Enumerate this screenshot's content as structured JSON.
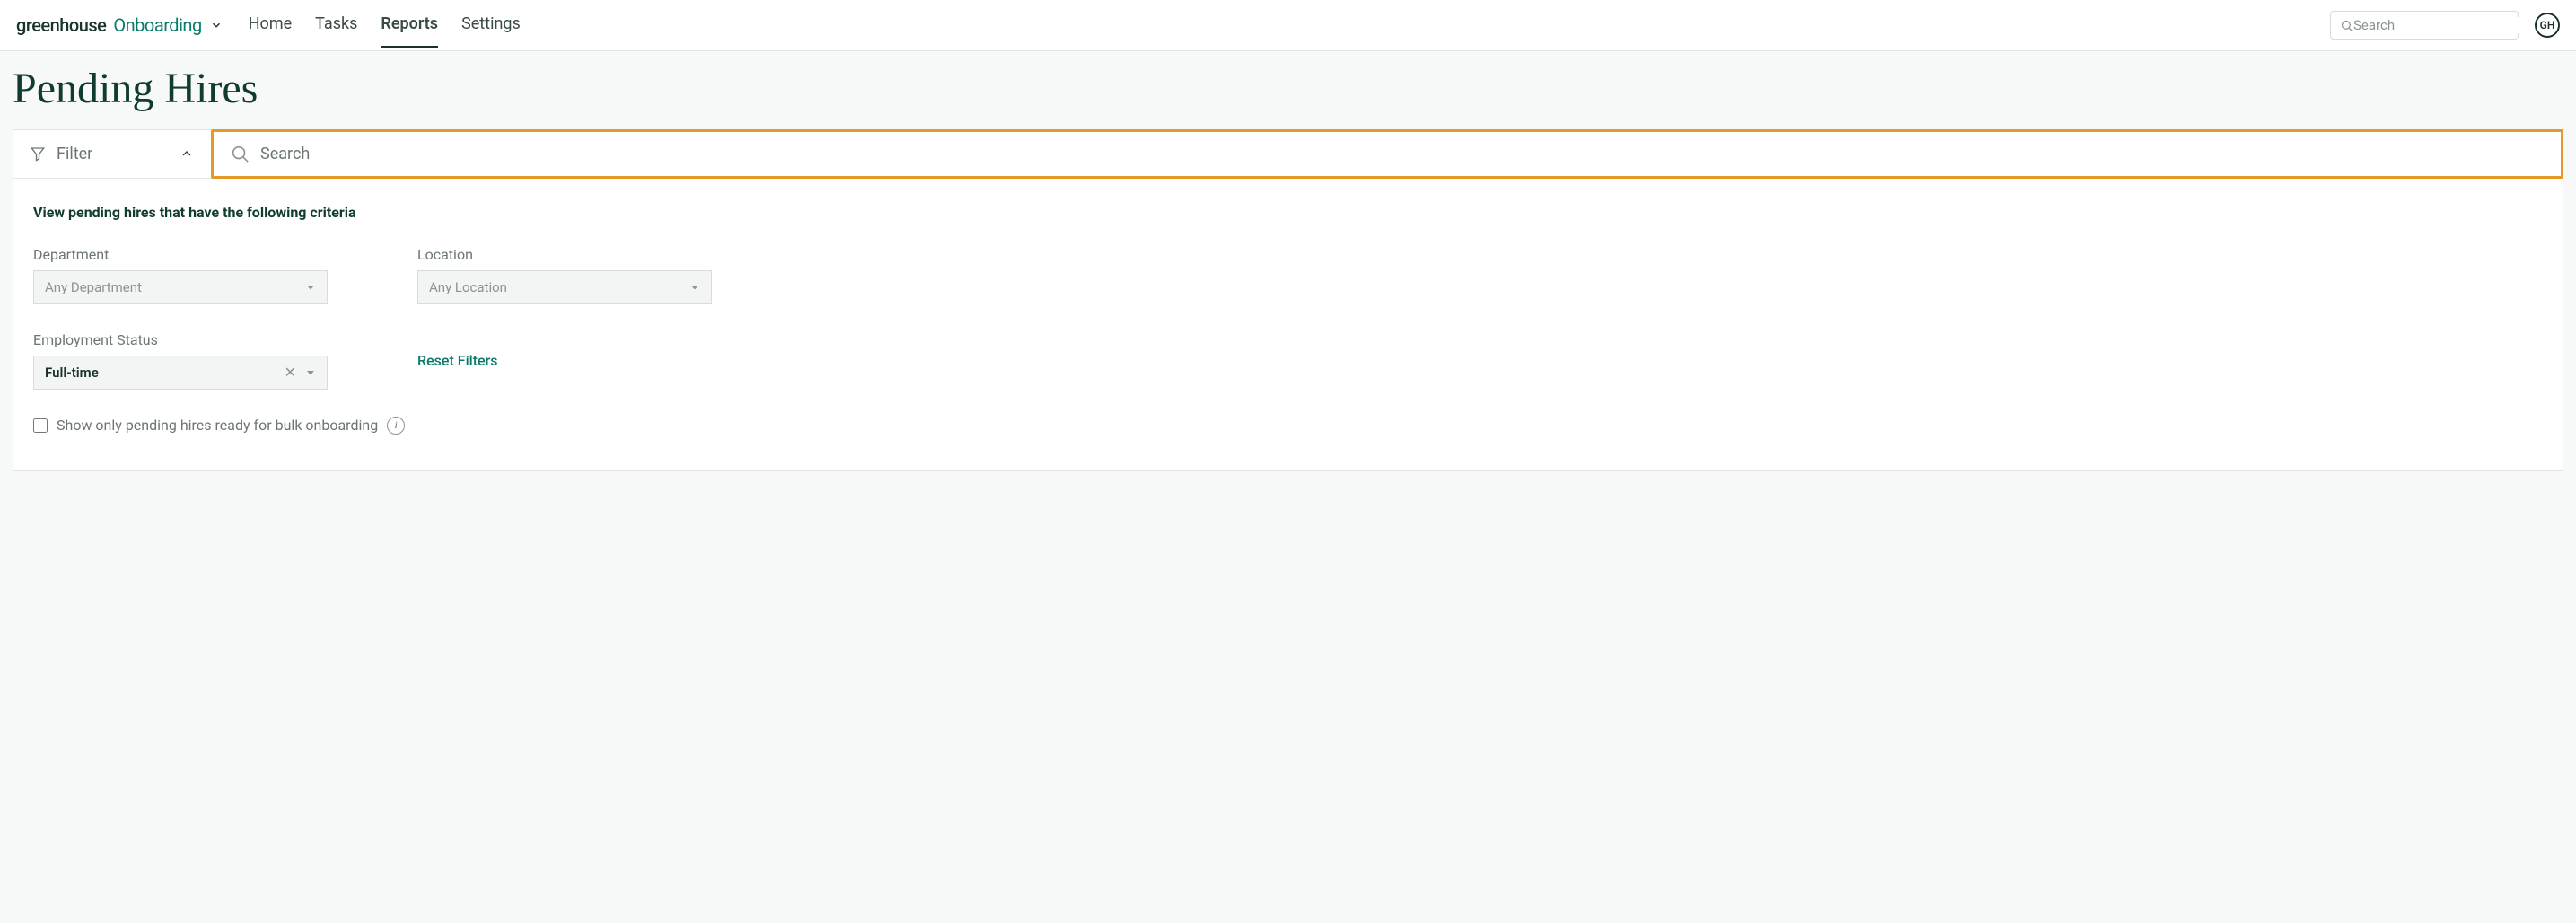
{
  "brand": {
    "name1": "greenhouse",
    "name2": "Onboarding"
  },
  "nav": {
    "items": [
      "Home",
      "Tasks",
      "Reports",
      "Settings"
    ],
    "active_index": 2
  },
  "top_search": {
    "placeholder": "Search"
  },
  "avatar": {
    "initials": "GH"
  },
  "page": {
    "title": "Pending Hires"
  },
  "filter_toggle": {
    "label": "Filter"
  },
  "panel_search": {
    "placeholder": "Search"
  },
  "filters": {
    "subtitle": "View pending hires that have the following criteria",
    "department": {
      "label": "Department",
      "value": "Any Department",
      "has_value": false
    },
    "location": {
      "label": "Location",
      "value": "Any Location",
      "has_value": false
    },
    "employment_status": {
      "label": "Employment Status",
      "value": "Full-time",
      "has_value": true
    },
    "reset_label": "Reset Filters",
    "bulk_checkbox_label": "Show only pending hires ready for bulk onboarding"
  }
}
